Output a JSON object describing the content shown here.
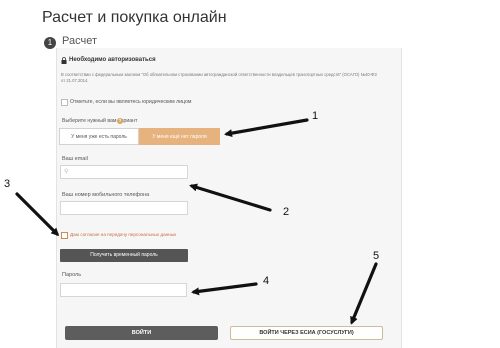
{
  "page": {
    "title": "Расчет и покупка онлайн",
    "step_number": "1",
    "step_label": "Расчет"
  },
  "notice": {
    "title": "Необходимо авторизоваться",
    "body": "В соответствии с федеральным законом \"Об обязательном страховании автогражданской ответственности владельцев транспортных средств\" (ОСАГО) №40-ФЗ от 21.07.2014."
  },
  "form": {
    "legal_entity_label": "Отметьте, если вы являетесь юридическим лицом",
    "choose_label": "Выберите нужный вам вариант",
    "help_icon": "?",
    "toggle": {
      "have_password": "У меня уже есть пароль",
      "no_password": "У меня ещё нет пароля"
    },
    "email_label": "Ваш email",
    "email_value": "",
    "phone_label": "Ваш номер мобильного телефона",
    "phone_value": "",
    "consent_label": "Даю согласие на передачу персональных данных",
    "temp_password_button": "Получить временный пароль",
    "password_label": "Пароль",
    "password_value": "",
    "login_button": "ВОЙТИ",
    "esia_button": "ВОЙТИ ЧЕРЕЗ ЕСИА (ГОСУСЛУГИ)"
  },
  "annotations": {
    "n1": "1",
    "n2": "2",
    "n3": "3",
    "n4": "4",
    "n5": "5"
  },
  "icons": {
    "lock": "lock-icon",
    "help": "help-icon",
    "location": "location-pin-icon"
  },
  "colors": {
    "accent": "#e6b27d",
    "dark_button": "#555555",
    "consent_text": "#c56c3e"
  }
}
